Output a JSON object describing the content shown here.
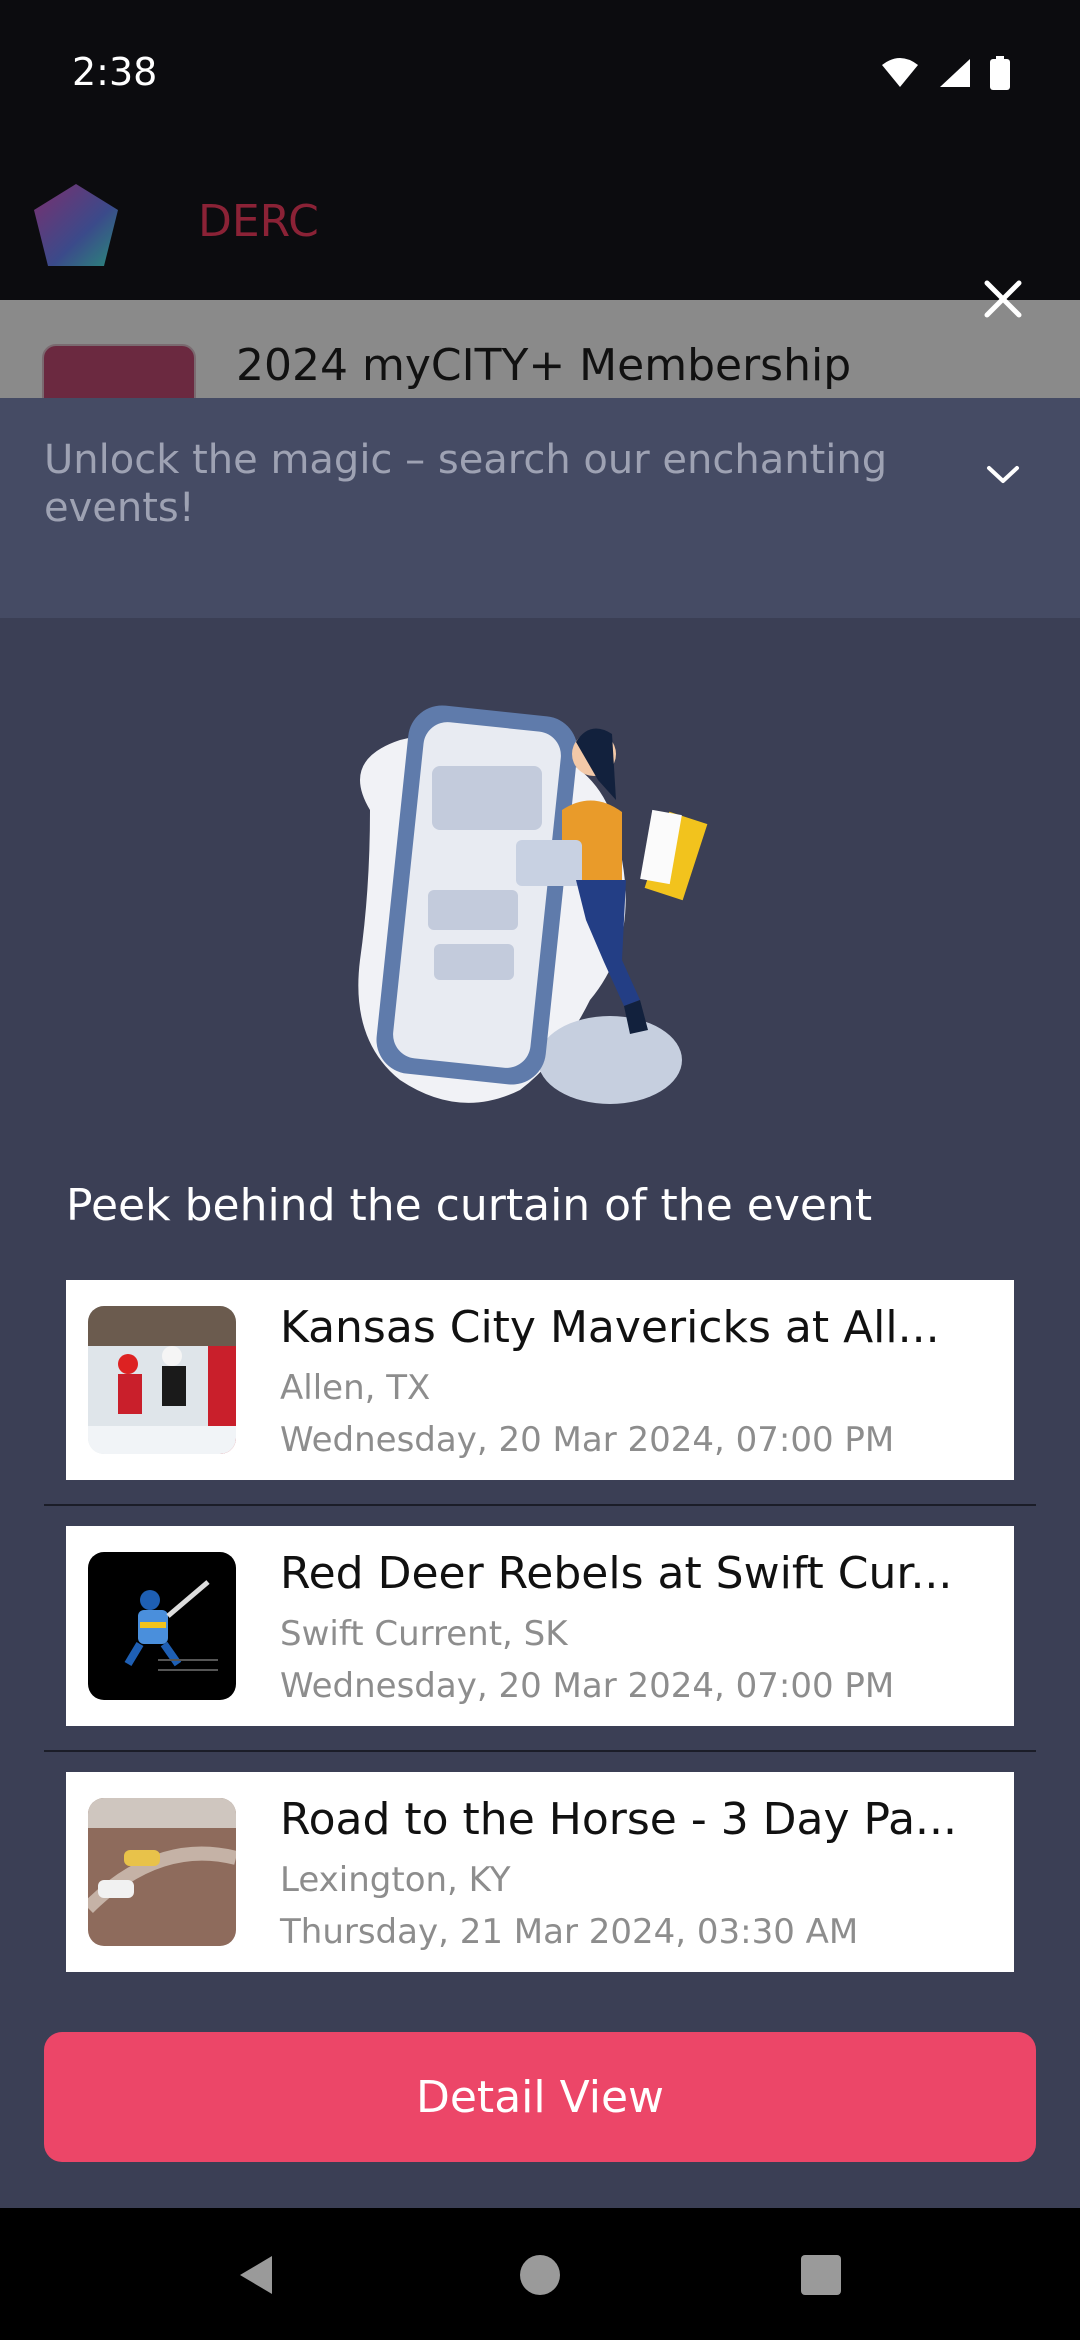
{
  "status_bar": {
    "time": "2:38"
  },
  "app_header": {
    "name": "DERC"
  },
  "background_item": {
    "title": "2024 myCITY+ Membership"
  },
  "search": {
    "text": "Unlock the magic – search our enchanting events!"
  },
  "section": {
    "title": "Peek behind the curtain of the event"
  },
  "events": [
    {
      "name": "Kansas City Mavericks at All...",
      "location": "Allen, TX",
      "date": "Wednesday, 20 Mar 2024, 07:00 PM"
    },
    {
      "name": "Red Deer Rebels at Swift Cur...",
      "location": "Swift Current, SK",
      "date": "Wednesday, 20 Mar 2024, 07:00 PM"
    },
    {
      "name": "Road to the Horse - 3 Day Pa...",
      "location": "Lexington, KY",
      "date": "Thursday, 21 Mar 2024, 03:30 AM"
    }
  ],
  "detail_button": {
    "label": "Detail View"
  },
  "colors": {
    "accent": "#ec4668",
    "sheet_bg": "#3b3f55",
    "search_bg": "#454b64",
    "brand": "#8b2236"
  },
  "icons": [
    "wifi-icon",
    "signal-icon",
    "battery-icon",
    "app-logo-icon",
    "close-icon",
    "chevron-down-icon",
    "back-icon",
    "home-icon",
    "recents-icon"
  ]
}
